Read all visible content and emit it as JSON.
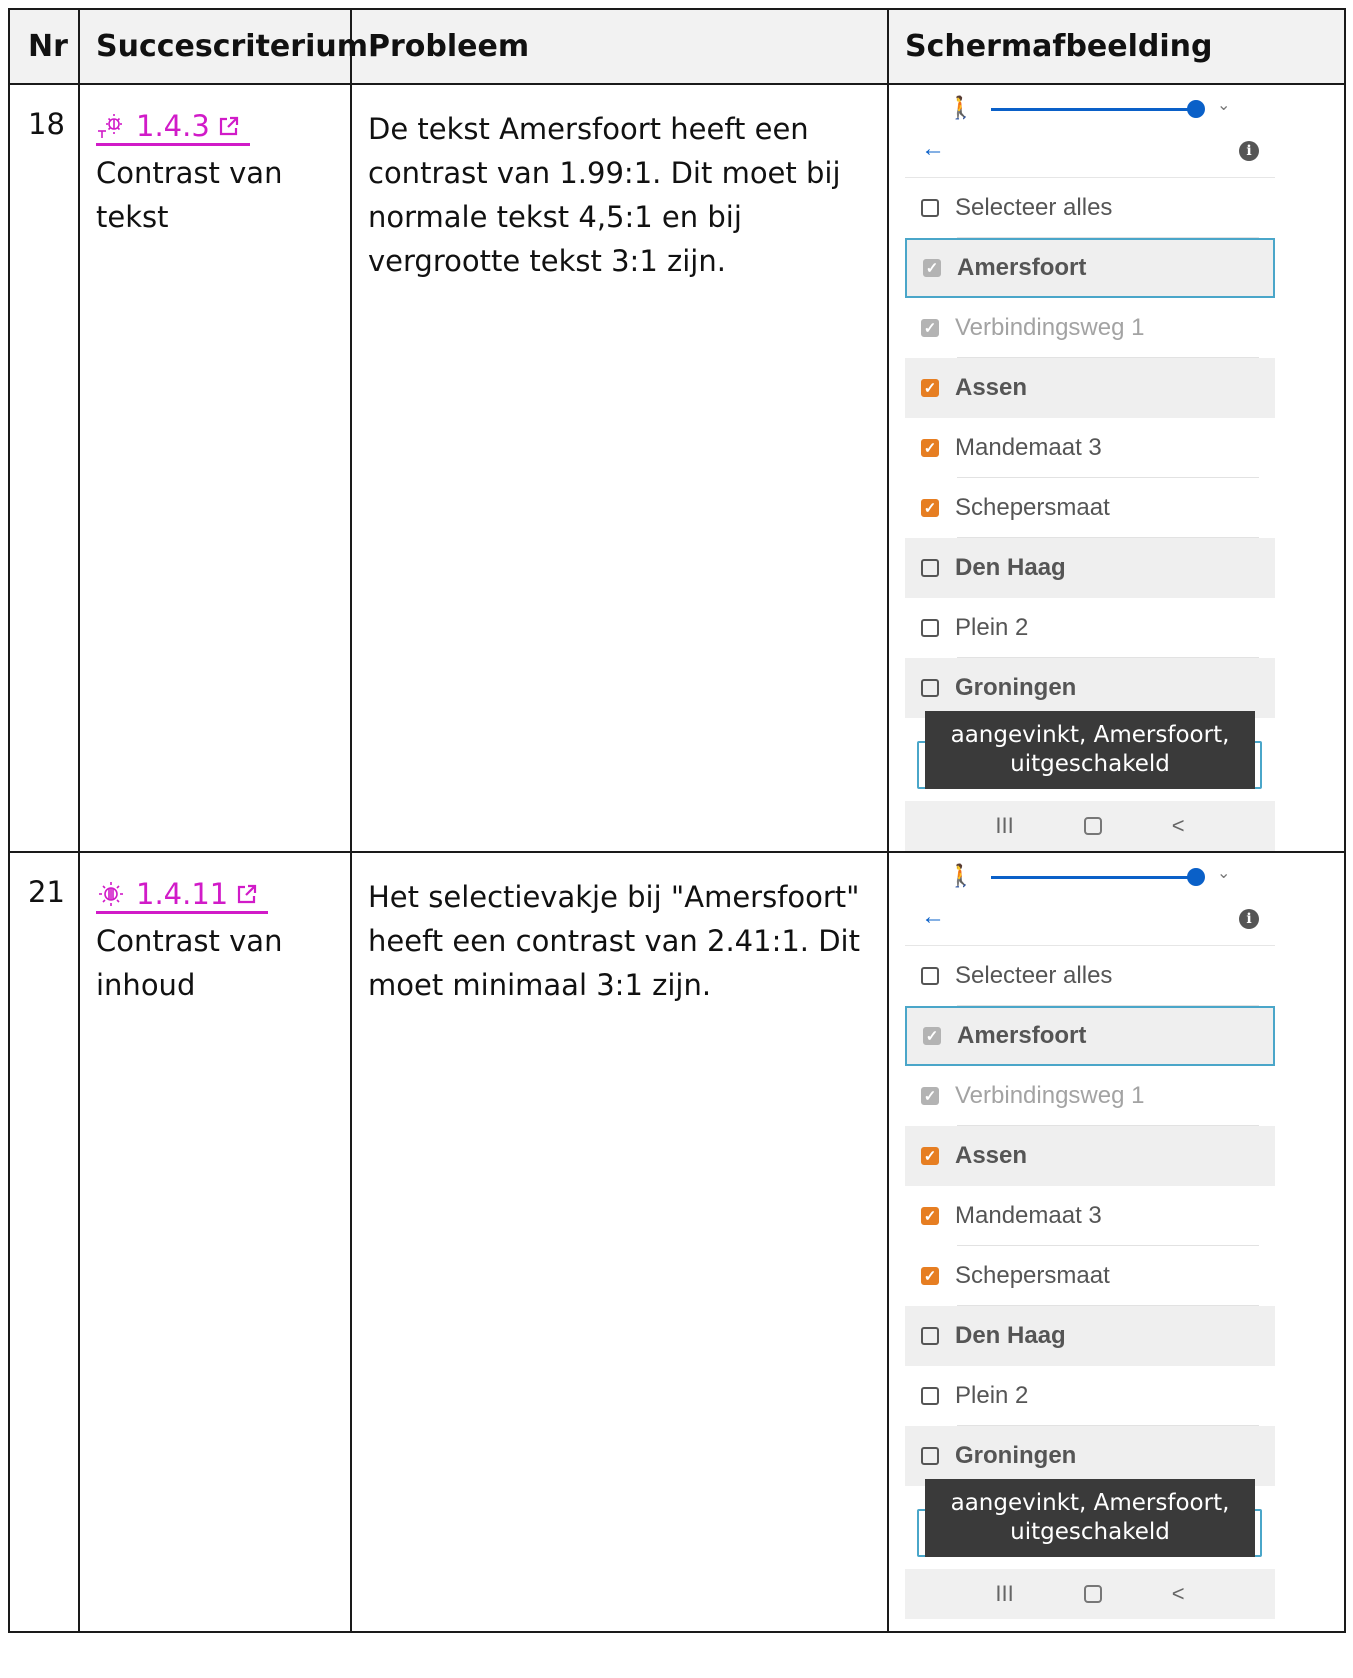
{
  "table": {
    "headers": [
      "Nr",
      "Succescriterium",
      "Probleem",
      "Schermafbeelding"
    ],
    "rows": [
      {
        "nr": "18",
        "criterion_code": "1.4.3",
        "criterion_name": "Contrast van tekst",
        "problem": "De tekst Amersfoort heeft een contrast van 1.99:1. Dit moet bij normale tekst 4,5:1 en bij vergrootte tekst 3:1 zijn.",
        "criterion_icon": "text-contrast-icon"
      },
      {
        "nr": "21",
        "criterion_code": "1.4.11",
        "criterion_name": "Contrast van inhoud",
        "problem": "Het selectievakje bij \"Amersfoort\" heeft een contrast van 2.41:1. Dit moet minimaal 3:1 zijn.",
        "criterion_icon": "non-text-contrast-icon"
      }
    ]
  },
  "screenshot": {
    "items": [
      {
        "label": "Selecteer alles",
        "state": "unchecked",
        "group": false,
        "disabled": false
      },
      {
        "label": "Amersfoort",
        "state": "checked",
        "group": true,
        "disabled": true,
        "focused": true
      },
      {
        "label": "Verbindingsweg 1",
        "state": "checked",
        "group": false,
        "disabled": true
      },
      {
        "label": "Assen",
        "state": "checked",
        "group": true,
        "disabled": false
      },
      {
        "label": "Mandemaat 3",
        "state": "checked",
        "group": false,
        "disabled": false
      },
      {
        "label": "Schepersmaat",
        "state": "checked",
        "group": false,
        "disabled": false
      },
      {
        "label": "Den Haag",
        "state": "unchecked",
        "group": true,
        "disabled": false
      },
      {
        "label": "Plein 2",
        "state": "unchecked",
        "group": false,
        "disabled": false
      },
      {
        "label": "Groningen",
        "state": "unchecked",
        "group": true,
        "disabled": false
      }
    ],
    "toast_line1": "aangevinkt, Amersfoort,",
    "toast_line2": "uitgeschakeld",
    "nav": [
      "III",
      "<"
    ],
    "colors": {
      "accent": "#0a60c8",
      "checkbox_checked": "#e67e22",
      "checkbox_disabled": "#b3b3b3",
      "link": "#d11bc8"
    }
  }
}
